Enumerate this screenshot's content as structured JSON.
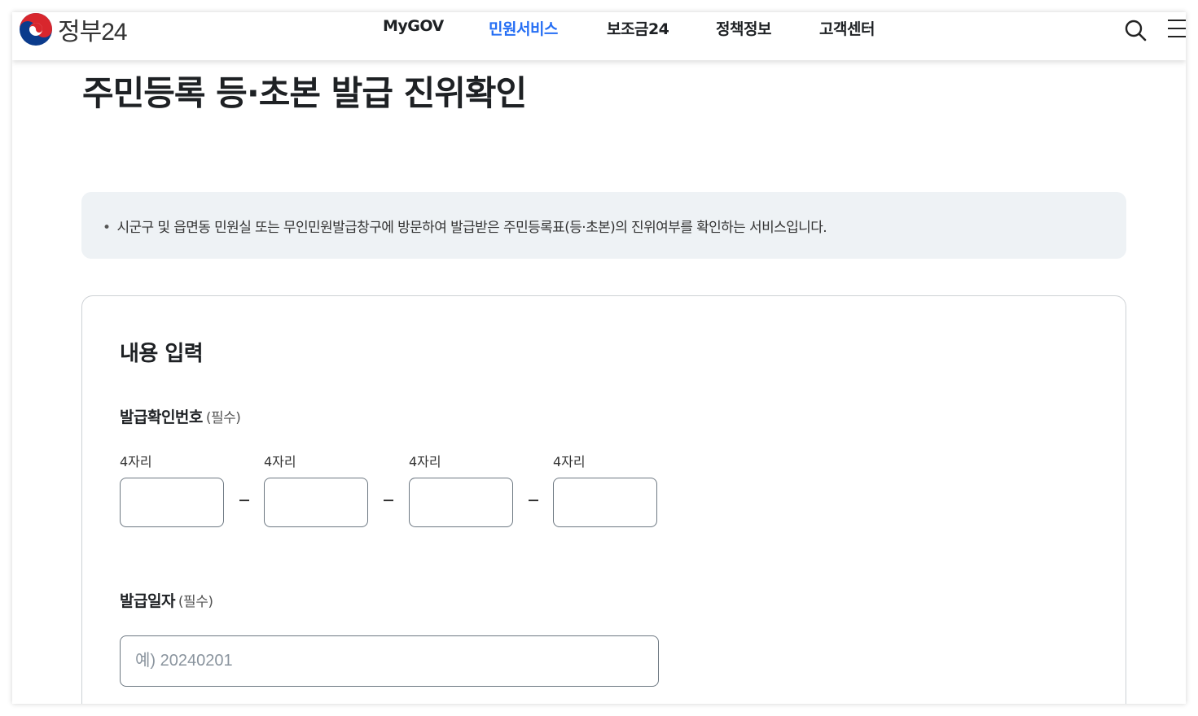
{
  "header": {
    "logo_text": "정부24",
    "nav": [
      {
        "label": "MyGOV",
        "active": false
      },
      {
        "label": "민원서비스",
        "active": true
      },
      {
        "label": "보조금24",
        "active": false
      },
      {
        "label": "정책정보",
        "active": false
      },
      {
        "label": "고객센터",
        "active": false
      }
    ],
    "icons": [
      "search-icon",
      "menu-icon"
    ],
    "active_color": "#256ef4"
  },
  "page": {
    "title": "주민등록 등·초본 발급 진위확인"
  },
  "notice": {
    "text": "시군구 및 읍면동 민원실 또는 무인민원발급창구에 방문하여 발급받은 주민등록표(등·초본)의 진위여부를 확인하는 서비스입니다."
  },
  "form": {
    "section_title": "내용 입력",
    "issue_number": {
      "label": "발급확인번호",
      "required": "(필수)",
      "parts": [
        {
          "label": "4자리",
          "value": ""
        },
        {
          "label": "4자리",
          "value": ""
        },
        {
          "label": "4자리",
          "value": ""
        },
        {
          "label": "4자리",
          "value": ""
        }
      ]
    },
    "issue_date": {
      "label": "발급일자",
      "required": "(필수)",
      "value": "",
      "placeholder": "예) 20240201"
    }
  }
}
